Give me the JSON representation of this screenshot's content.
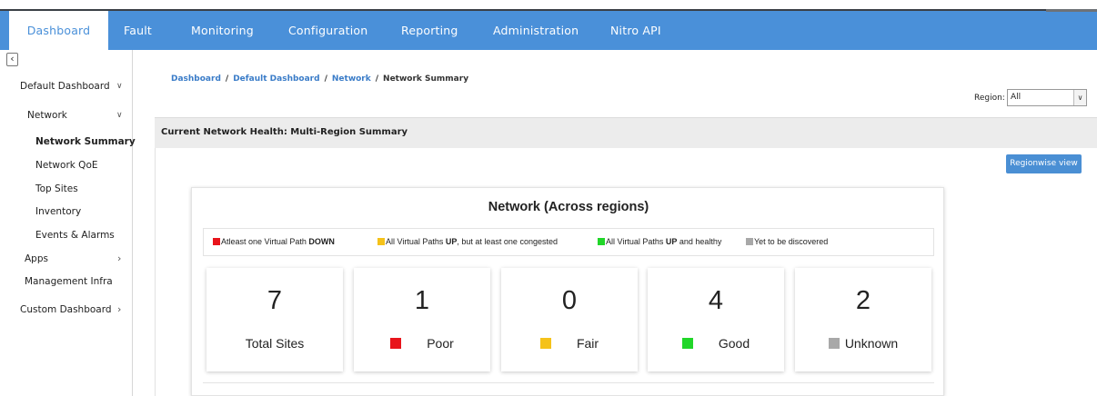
{
  "nav": {
    "tabs": [
      {
        "label": "Dashboard",
        "active": true
      },
      {
        "label": "Fault"
      },
      {
        "label": "Monitoring"
      },
      {
        "label": "Configuration"
      },
      {
        "label": "Reporting"
      },
      {
        "label": "Administration"
      },
      {
        "label": "Nitro API"
      }
    ]
  },
  "sidebar": {
    "collapse_glyph": "‹",
    "items": [
      {
        "label": "Default Dashboard"
      },
      {
        "label": "Network"
      },
      {
        "label": "Network Summary",
        "selected": true
      },
      {
        "label": "Network QoE"
      },
      {
        "label": "Top Sites"
      },
      {
        "label": "Inventory"
      },
      {
        "label": "Events & Alarms"
      },
      {
        "label": "Apps"
      },
      {
        "label": "Management Infra"
      },
      {
        "label": "Custom Dashboard"
      }
    ]
  },
  "breadcrumb": {
    "items": [
      "Dashboard",
      "Default Dashboard",
      "Network",
      "Network Summary"
    ],
    "separator": "/"
  },
  "region": {
    "label": "Region:",
    "value": "All"
  },
  "section": {
    "title": "Current Network Health: Multi-Region Summary"
  },
  "regionwise_button": "Regionwise view",
  "card": {
    "title": "Network (Across regions)",
    "legend": [
      {
        "prefix": "Atleast one Virtual Path ",
        "bold": "DOWN",
        "suffix": "",
        "color": "#e8141b"
      },
      {
        "prefix": "All Virtual Paths ",
        "bold": "UP",
        "suffix": ", but at least one congested",
        "color": "#f5c21a"
      },
      {
        "prefix": "All Virtual Paths ",
        "bold": "UP",
        "suffix": " and healthy",
        "color": "#21d629"
      },
      {
        "prefix": "Yet to be discovered",
        "bold": "",
        "suffix": "",
        "color": "#a8a8a8"
      }
    ],
    "stats": [
      {
        "value": "7",
        "label": "Total Sites"
      },
      {
        "value": "1",
        "label": "Poor",
        "color": "#e8141b"
      },
      {
        "value": "0",
        "label": "Fair",
        "color": "#f5c21a"
      },
      {
        "value": "4",
        "label": "Good",
        "color": "#21d629"
      },
      {
        "value": "2",
        "label": "Unknown",
        "color": "#a8a8a8"
      }
    ]
  },
  "colors": {
    "nav_bg": "#4a90d9",
    "link": "#3a7cc8",
    "button": "#4a8fd4"
  }
}
